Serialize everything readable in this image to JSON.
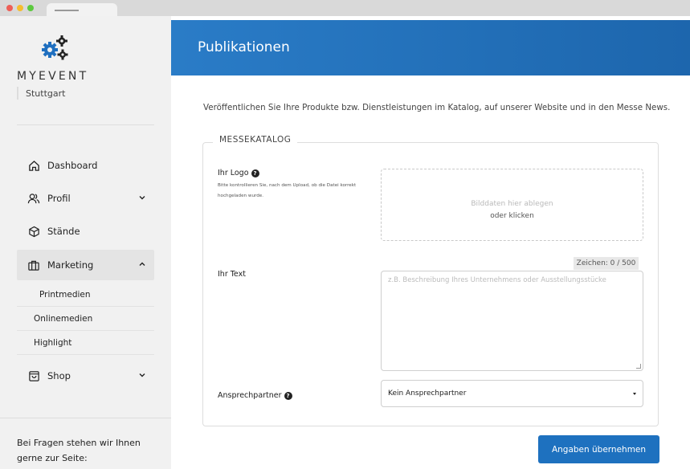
{
  "browser": {
    "tab_title": ""
  },
  "sidebar": {
    "brand": "MYEVENT",
    "city": "Stuttgart",
    "nav": [
      {
        "label": "Dashboard",
        "icon": "home-icon"
      },
      {
        "label": "Profil",
        "icon": "users-icon"
      },
      {
        "label": "Stände",
        "icon": "cube-icon"
      },
      {
        "label": "Marketing",
        "icon": "briefcase-icon"
      },
      {
        "label": "Shop",
        "icon": "shopping-bag-icon"
      }
    ],
    "sub_items": [
      "Printmedien",
      "Onlinemedien",
      "Highlight"
    ],
    "help_text": "Bei Fragen stehen wir Ihnen gerne zur Seite:"
  },
  "header": {
    "title": "Publikationen"
  },
  "main": {
    "intro": "Veröffentlichen Sie Ihre Produkte bzw. Dienstleistungen im Katalog, auf unserer Website und in den Messe News.",
    "section_title": "MESSEKATALOG",
    "logo": {
      "label": "Ihr Logo",
      "hint": "Bitte kontrollieren Sie, nach dem Upload, ob die Datei korrekt hochgeladen wurde.",
      "dropzone_line1": "Bilddaten hier ablegen",
      "dropzone_line2": "oder klicken"
    },
    "text": {
      "label": "Ihr Text",
      "counter": "Zeichen: 0 / 500",
      "placeholder": "z.B. Beschreibung Ihres Unternehmens oder Ausstellungsstücke"
    },
    "contact": {
      "label": "Ansprechpartner",
      "selected": "Kein Ansprechpartner"
    },
    "submit_label": "Angaben übernehmen"
  },
  "colors": {
    "accent": "#1e71bf",
    "header_start": "#2a7cc7",
    "header_end": "#1d66ad"
  }
}
